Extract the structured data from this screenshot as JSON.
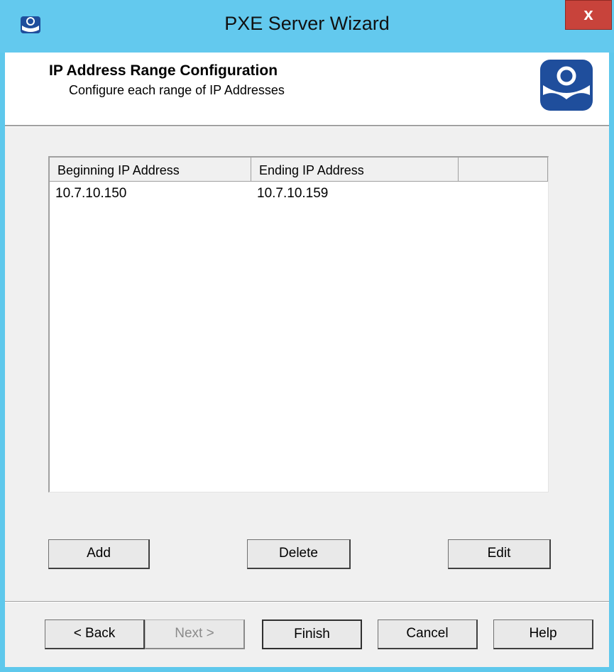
{
  "window": {
    "title": "PXE Server Wizard",
    "close_label": "x",
    "app_icon": "thinmanager-logo-icon",
    "colors": {
      "titlebar": "#63c9ee",
      "close": "#c8433b",
      "logo": "#1f4e9c"
    }
  },
  "header": {
    "title": "IP Address Range Configuration",
    "subtitle": "Configure each range of IP Addresses",
    "logo_icon": "thinmanager-logo-icon"
  },
  "table": {
    "columns": [
      "Beginning IP Address",
      "Ending IP Address",
      ""
    ],
    "rows": [
      [
        "10.7.10.150",
        "10.7.10.159"
      ]
    ]
  },
  "actions": {
    "add": "Add",
    "delete": "Delete",
    "edit": "Edit"
  },
  "footer": {
    "back": "< Back",
    "next": "Next >",
    "finish": "Finish",
    "cancel": "Cancel",
    "help": "Help"
  }
}
